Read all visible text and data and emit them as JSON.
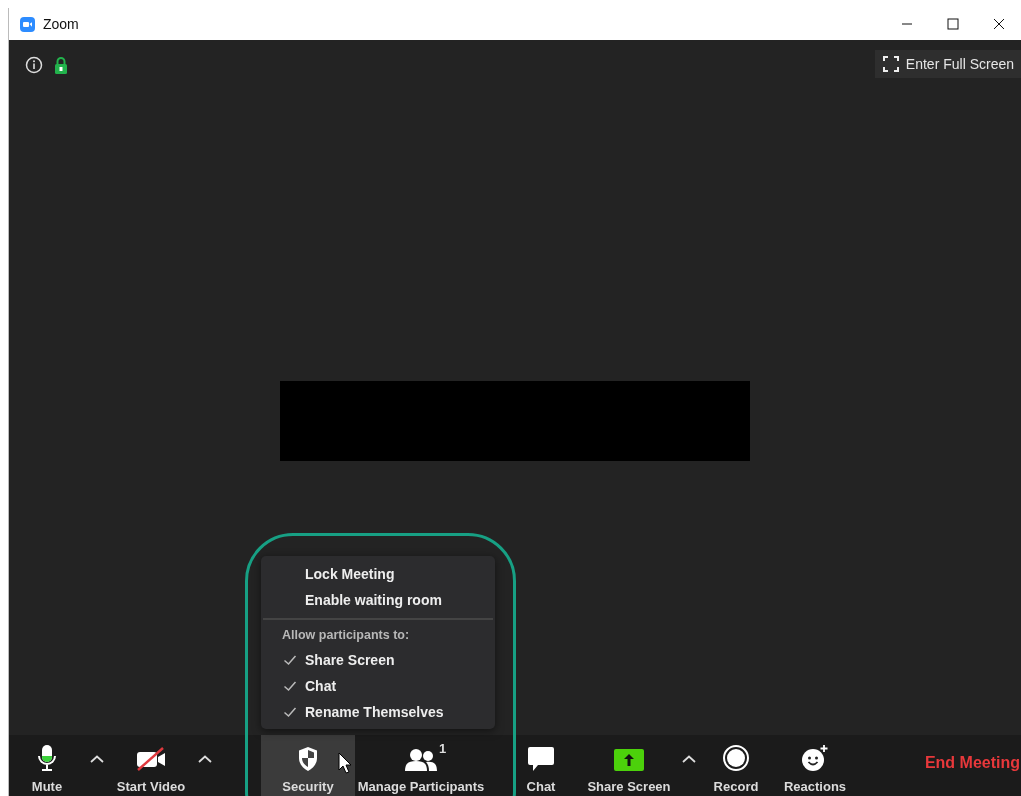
{
  "window": {
    "title": "Zoom"
  },
  "top_bar": {
    "fullscreen_button": "Enter Full Screen"
  },
  "security_menu": {
    "options": [
      {
        "label": "Lock Meeting",
        "checked": false
      },
      {
        "label": "Enable waiting room",
        "checked": false
      }
    ],
    "section_label": "Allow participants to:",
    "permissions": [
      {
        "label": "Share Screen",
        "checked": true
      },
      {
        "label": "Chat",
        "checked": true
      },
      {
        "label": "Rename Themselves",
        "checked": true
      }
    ]
  },
  "toolbar": {
    "buttons": [
      {
        "kind": "mute",
        "label": "Mute",
        "selected": false
      },
      {
        "kind": "caret",
        "selected": false
      },
      {
        "kind": "video",
        "label": "Start Video",
        "selected": false
      },
      {
        "kind": "caret",
        "selected": false
      },
      {
        "kind": "security",
        "label": "Security",
        "selected": true
      },
      {
        "kind": "participants",
        "label": "Manage Participants",
        "count": "1",
        "selected": false
      },
      {
        "kind": "chat",
        "label": "Chat",
        "selected": false
      },
      {
        "kind": "share",
        "label": "Share Screen",
        "selected": false
      },
      {
        "kind": "caret",
        "selected": false
      },
      {
        "kind": "record",
        "label": "Record",
        "selected": false
      },
      {
        "kind": "reactions",
        "label": "Reactions",
        "selected": false
      }
    ],
    "end_button": "End Meeting"
  }
}
